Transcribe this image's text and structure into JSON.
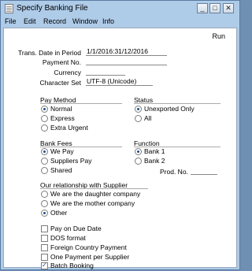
{
  "window": {
    "title": "Specify Banking File",
    "min": "_",
    "max": "□",
    "close": "✕"
  },
  "menu": [
    "File",
    "Edit",
    "Record",
    "Window",
    "Info"
  ],
  "toolbar": {
    "run": "Run"
  },
  "fields": [
    {
      "label": "Trans. Date in Period",
      "value": "1/1/2016:31/12/2016"
    },
    {
      "label": "Payment No.",
      "value": ""
    },
    {
      "label": "Currency",
      "value": ""
    },
    {
      "label": "Character Set",
      "value": "UTF-8 (Unicode)"
    }
  ],
  "pay_method": {
    "title": "Pay Method",
    "options": [
      "Normal",
      "Express",
      "Extra Urgent"
    ],
    "selected": 0
  },
  "status": {
    "title": "Status",
    "options": [
      "Unexported Only",
      "All"
    ],
    "selected": 0
  },
  "bank_fees": {
    "title": "Bank Fees",
    "options": [
      "We Pay",
      "Suppliers Pay",
      "Shared"
    ],
    "selected": 0
  },
  "function": {
    "title": "Function",
    "options": [
      "Bank 1",
      "Bank 2"
    ],
    "selected": 0
  },
  "prod_no": {
    "label": "Prod. No.",
    "value": ""
  },
  "relationship": {
    "title": "Our relationship with Supplier",
    "options": [
      "We are the daughter company",
      "We are the mother company",
      "Other"
    ],
    "selected": 2
  },
  "checkboxes": [
    {
      "label": "Pay on Due Date",
      "checked": false
    },
    {
      "label": "DOS format",
      "checked": false
    },
    {
      "label": "Foreign Country Payment",
      "checked": false
    },
    {
      "label": "One Payment per Supplier",
      "checked": false
    },
    {
      "label": "Batch Booking",
      "checked": true
    }
  ]
}
